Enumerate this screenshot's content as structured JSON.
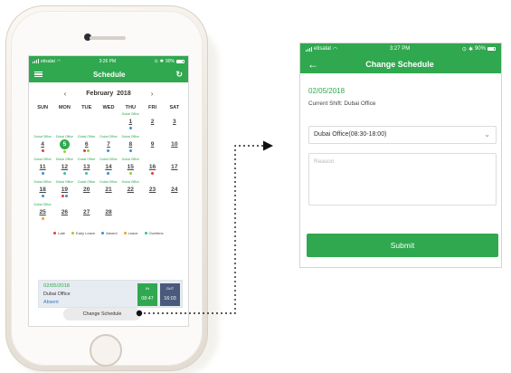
{
  "colors": {
    "brand_green": "#2fa84f",
    "late": "#e23b3b",
    "early_leave": "#9acd32",
    "absent": "#3a8fd6",
    "leave": "#f0a030",
    "overtime": "#3fb8a8",
    "out_badge": "#4a5a7d"
  },
  "left_phone": {
    "status": {
      "carrier": "etisalat",
      "time": "3:26 PM",
      "battery": "90%"
    },
    "appbar": {
      "menu_icon": "hamburger-icon",
      "title": "Schedule",
      "refresh_icon": "refresh-icon"
    },
    "calendar": {
      "prev_icon": "chevron-left-icon",
      "month": "February",
      "year": "2018",
      "next_icon": "chevron-right-icon",
      "weekdays": [
        "SUN",
        "MON",
        "TUE",
        "WED",
        "THU",
        "FRI",
        "SAT"
      ],
      "weeks": [
        [
          null,
          null,
          null,
          null,
          {
            "day": "1",
            "office": "Dubai Office",
            "dots": [
              "absent"
            ]
          },
          {
            "day": "2",
            "office": ""
          },
          {
            "day": "3",
            "office": ""
          }
        ],
        [
          {
            "day": "4",
            "office": "Dubai Office",
            "dots": [
              "late"
            ]
          },
          {
            "day": "5",
            "office": "Dubai Office",
            "dots": [
              "early_leave"
            ],
            "today": true
          },
          {
            "day": "6",
            "office": "Dubai Office",
            "dots": [
              "late",
              "early_leave"
            ]
          },
          {
            "day": "7",
            "office": "Dubai Office",
            "dots": [
              "absent"
            ]
          },
          {
            "day": "8",
            "office": "Dubai Office",
            "dots": [
              "absent"
            ]
          },
          {
            "day": "9",
            "office": ""
          },
          {
            "day": "10",
            "office": ""
          }
        ],
        [
          {
            "day": "11",
            "office": "Dubai Office",
            "dots": [
              "absent"
            ]
          },
          {
            "day": "12",
            "office": "Dubai Office",
            "dots": [
              "overtime"
            ]
          },
          {
            "day": "13",
            "office": "Dubai Office",
            "dots": [
              "overtime"
            ]
          },
          {
            "day": "14",
            "office": "Dubai Office",
            "dots": [
              "absent"
            ]
          },
          {
            "day": "15",
            "office": "Dubai Office",
            "dots": [
              "early_leave"
            ]
          },
          {
            "day": "16",
            "office": "",
            "dots": [
              "late"
            ]
          },
          {
            "day": "17",
            "office": ""
          }
        ],
        [
          {
            "day": "18",
            "office": "Dubai Office",
            "dots": [
              "absent"
            ]
          },
          {
            "day": "19",
            "office": "Dubai Office",
            "dots": [
              "late",
              "absent"
            ]
          },
          {
            "day": "20",
            "office": "Dubai Office"
          },
          {
            "day": "21",
            "office": "Dubai Office"
          },
          {
            "day": "22",
            "office": "Dubai Office"
          },
          {
            "day": "23",
            "office": ""
          },
          {
            "day": "24",
            "office": ""
          }
        ],
        [
          {
            "day": "25",
            "office": "Dubai Office",
            "dots": [
              "leave"
            ]
          },
          {
            "day": "26",
            "office": ""
          },
          {
            "day": "27",
            "office": ""
          },
          {
            "day": "28",
            "office": ""
          },
          null,
          null,
          null
        ]
      ]
    },
    "legend": [
      {
        "key": "late",
        "label": "Late"
      },
      {
        "key": "early_leave",
        "label": "Early Leave"
      },
      {
        "key": "absent",
        "label": "Absent"
      },
      {
        "key": "leave",
        "label": "Leave"
      },
      {
        "key": "overtime",
        "label": "Overtime"
      }
    ],
    "shift_card": {
      "date": "02/05/2018",
      "place": "Dubai Office",
      "status": "Absent",
      "in_label": "IN",
      "in_time": "08:47",
      "out_label": "OUT",
      "out_time": "16:03"
    },
    "change_button": "Change Schedule"
  },
  "right_phone": {
    "status": {
      "carrier": "etisalat",
      "time": "3:27 PM",
      "battery": "90%"
    },
    "appbar": {
      "back_icon": "back-arrow-icon",
      "title": "Change Schedule"
    },
    "date": "02/05/2018",
    "current_shift": "Current Shift: Dubai Office",
    "schedule_select": {
      "selected": "Dubai Office(08:30-18:00)",
      "icon": "chevron-down-icon"
    },
    "reason": {
      "placeholder": "Reason",
      "value": ""
    },
    "submit_label": "Submit"
  }
}
